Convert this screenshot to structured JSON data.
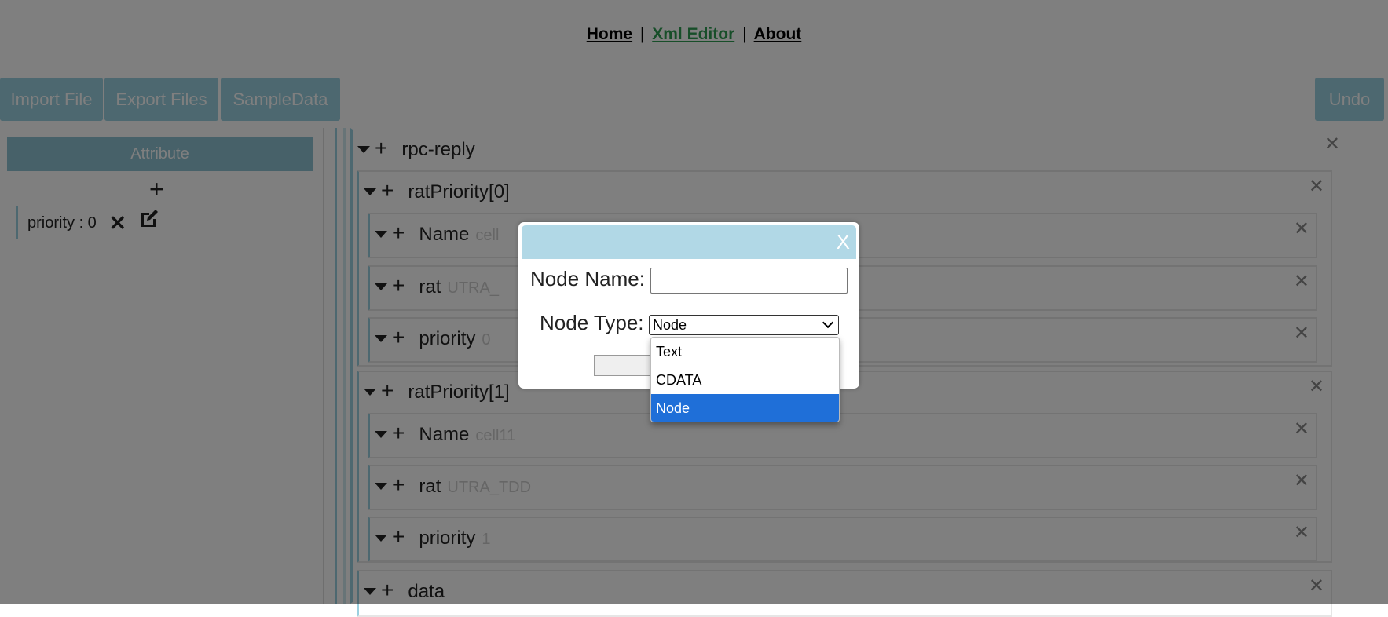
{
  "nav": {
    "home": "Home",
    "sep1": "|",
    "xml_editor": "Xml Editor",
    "sep2": "|",
    "about": "About"
  },
  "toolbar": {
    "import": "Import File",
    "export": "Export Files",
    "sample": "SampleData",
    "undo": "Undo"
  },
  "attribute_panel": {
    "header": "Attribute",
    "add": "+",
    "items": [
      {
        "label": "priority : 0"
      }
    ]
  },
  "tree": {
    "root": "rpc-reply",
    "nodes": [
      {
        "name": "ratPriority[0]",
        "children": [
          {
            "name": "Name",
            "value": "cell"
          },
          {
            "name": "rat",
            "value": "UTRA_"
          },
          {
            "name": "priority",
            "value": "0"
          }
        ]
      },
      {
        "name": "ratPriority[1]",
        "children": [
          {
            "name": "Name",
            "value": "cell11"
          },
          {
            "name": "rat",
            "value": "UTRA_TDD"
          },
          {
            "name": "priority",
            "value": "1"
          }
        ]
      },
      {
        "name": "data"
      }
    ]
  },
  "modal": {
    "close": "X",
    "node_name_label": "Node Name:",
    "node_name_value": "",
    "node_type_label": "Node Type:",
    "node_type_selected": "Node",
    "options": [
      "Text",
      "CDATA",
      "Node"
    ]
  },
  "colors": {
    "accent": "#9bd0e0",
    "nav_active": "#2e9c52",
    "select_highlight": "#1f6fd8"
  }
}
